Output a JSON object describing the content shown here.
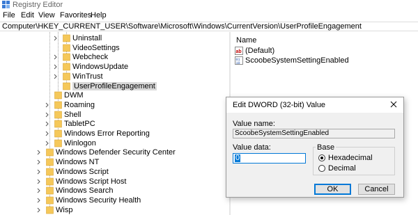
{
  "window": {
    "title": "Registry Editor"
  },
  "menu": {
    "items": [
      "File",
      "Edit",
      "View",
      "Favorites",
      "Help"
    ]
  },
  "address": {
    "path": "Computer\\HKEY_CURRENT_USER\\Software\\Microsoft\\Windows\\CurrentVersion\\UserProfileEngagement"
  },
  "tree": {
    "items": [
      {
        "label": "Uninstall",
        "has_children": true
      },
      {
        "label": "VideoSettings",
        "has_children": false
      },
      {
        "label": "Webcheck",
        "has_children": true
      },
      {
        "label": "WindowsUpdate",
        "has_children": true
      },
      {
        "label": "WinTrust",
        "has_children": true
      },
      {
        "label": "UserProfileEngagement",
        "has_children": false,
        "selected": true
      },
      {
        "label": "DWM",
        "has_children": false
      },
      {
        "label": "Roaming",
        "has_children": true
      },
      {
        "label": "Shell",
        "has_children": true
      },
      {
        "label": "TabletPC",
        "has_children": true
      },
      {
        "label": "Windows Error Reporting",
        "has_children": true
      },
      {
        "label": "Winlogon",
        "has_children": true
      },
      {
        "label": "Windows Defender Security Center",
        "has_children": true
      },
      {
        "label": "Windows NT",
        "has_children": true
      },
      {
        "label": "Windows Script",
        "has_children": true
      },
      {
        "label": "Windows Script Host",
        "has_children": true
      },
      {
        "label": "Windows Search",
        "has_children": true
      },
      {
        "label": "Windows Security Health",
        "has_children": true
      },
      {
        "label": "Wisp",
        "has_children": true
      }
    ]
  },
  "values": {
    "column_name": "Name",
    "items": [
      {
        "label": "(Default)",
        "icon": "string-value-icon"
      },
      {
        "label": "ScoobeSystemSettingEnabled",
        "icon": "dword-value-icon"
      }
    ]
  },
  "dialog": {
    "title": "Edit DWORD (32-bit) Value",
    "value_name_label": "Value name:",
    "value_name": "ScoobeSystemSettingEnabled",
    "value_data_label": "Value data:",
    "value_data": "0",
    "base_label": "Base",
    "hex_label": "Hexadecimal",
    "dec_label": "Decimal",
    "base_selected": "Hexadecimal",
    "ok_label": "OK",
    "cancel_label": "Cancel"
  },
  "colors": {
    "folder": "#f5c85a",
    "accent": "#0078d7",
    "selection": "#d9d9d9"
  }
}
